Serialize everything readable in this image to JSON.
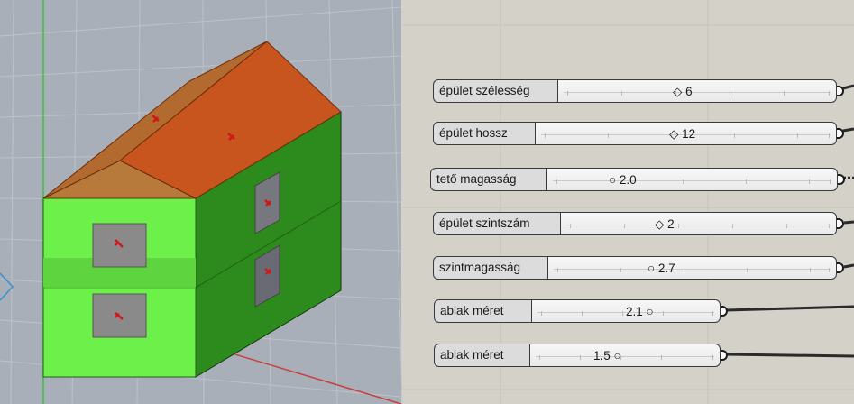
{
  "sliders": [
    {
      "label": "épület szélesség",
      "value": "6",
      "marker": "diamond"
    },
    {
      "label": "épület hossz",
      "value": "12",
      "marker": "diamond"
    },
    {
      "label": "tető magasság",
      "value": "2.0",
      "marker": "circle"
    },
    {
      "label": "épület szintszám",
      "value": "2",
      "marker": "diamond"
    },
    {
      "label": "szintmagasság",
      "value": "2.7",
      "marker": "circle"
    },
    {
      "label": "ablak méret",
      "value": "2.1",
      "marker": "circle"
    },
    {
      "label": "ablak méret",
      "value": "1.5",
      "marker": "circle"
    }
  ],
  "colors": {
    "canvas": "#d4d1c9",
    "viewport_bg": "#a9afb8",
    "roof": "#c8541e",
    "wall_front": "#6ef04a",
    "wall_side": "#2d8a1c",
    "window": "#8a8a8a",
    "slider_border": "#3a3a3a"
  }
}
